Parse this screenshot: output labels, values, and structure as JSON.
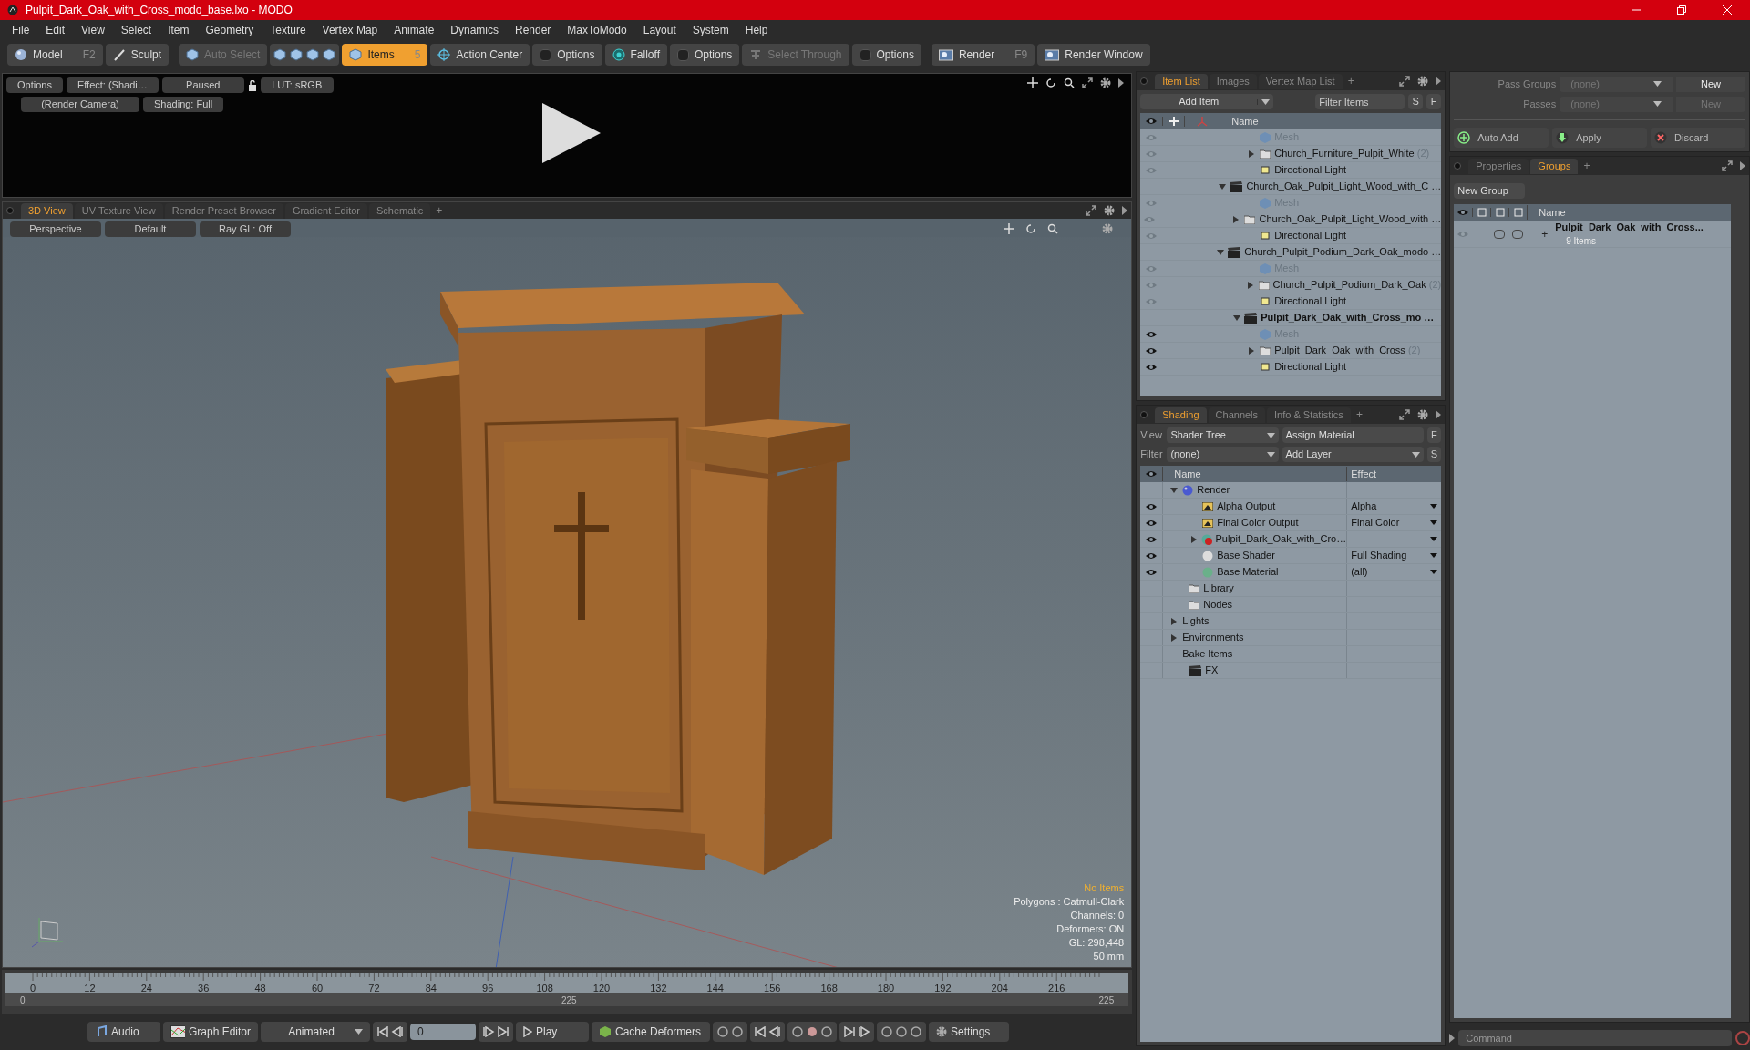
{
  "window": {
    "title": "Pulpit_Dark_Oak_with_Cross_modo_base.lxo - MODO"
  },
  "menu": [
    "File",
    "Edit",
    "View",
    "Select",
    "Item",
    "Geometry",
    "Texture",
    "Vertex Map",
    "Animate",
    "Dynamics",
    "Render",
    "MaxToModo",
    "Layout",
    "System",
    "Help"
  ],
  "toolbar": [
    {
      "kind": "sphere",
      "label": "Model",
      "shortcut": "F2",
      "selected": false,
      "disabled": false
    },
    {
      "kind": "brush",
      "label": "Sculpt",
      "selected": false,
      "disabled": false
    },
    {
      "kind": "cube",
      "label": "Auto Select",
      "selected": false,
      "disabled": true
    },
    {
      "kind": "cubes",
      "selected": false
    },
    {
      "kind": "cube",
      "label": "Items",
      "shortcut": "5",
      "selected": true,
      "disabled": false
    },
    {
      "kind": "target",
      "label": "Action Center",
      "selected": false,
      "disabled": false
    },
    {
      "kind": "options",
      "label": "Options",
      "selected": false,
      "disabled": false
    },
    {
      "kind": "falloff",
      "label": "Falloff",
      "selected": false,
      "disabled": false
    },
    {
      "kind": "options",
      "label": "Options",
      "selected": false,
      "disabled": false
    },
    {
      "kind": "through",
      "label": "Select Through",
      "selected": false,
      "disabled": true
    },
    {
      "kind": "options",
      "label": "Options",
      "selected": false,
      "disabled": false
    },
    {
      "kind": "render",
      "label": "Render",
      "shortcut": "F9",
      "selected": false,
      "disabled": false
    },
    {
      "kind": "render",
      "label": "Render Window",
      "selected": false,
      "disabled": false
    }
  ],
  "preview": {
    "row_1": [
      "Options",
      "Effect: (Shadi…",
      "Paused"
    ],
    "lut": "LUT: sRGB",
    "row_2": [
      "(Render Camera)",
      "Shading: Full"
    ]
  },
  "viewport_tabs": [
    {
      "label": "3D View",
      "selected": true
    },
    {
      "label": "UV Texture View",
      "selected": false
    },
    {
      "label": "Render Preset Browser",
      "selected": false
    },
    {
      "label": "Gradient Editor",
      "selected": false
    },
    {
      "label": "Schematic",
      "selected": false
    }
  ],
  "viewport_add_tab": "+",
  "viewport_bar": [
    "Perspective",
    "Default",
    "Ray GL: Off"
  ],
  "viewport_info": {
    "status": "No Items",
    "lines": [
      "Polygons : Catmull-Clark",
      "Channels: 0",
      "Deformers: ON",
      "GL: 298,448",
      "50 mm"
    ]
  },
  "timeline": {
    "ticks": [
      "0",
      "12",
      "24",
      "36",
      "48",
      "60",
      "72",
      "84",
      "96",
      "108",
      "120",
      "132",
      "144",
      "156",
      "168",
      "180",
      "192",
      "204",
      "216"
    ],
    "range": [
      "0",
      "225",
      "225"
    ]
  },
  "transport": {
    "audio": "Audio",
    "graph_editor": "Graph Editor",
    "mode": "Animated",
    "frame": "0",
    "play": "Play",
    "cache": "Cache Deformers",
    "settings": "Settings"
  },
  "item_list": {
    "tabs": [
      {
        "label": "Item List",
        "selected": true
      },
      {
        "label": "Images",
        "selected": false
      },
      {
        "label": "Vertex Map List",
        "selected": false
      }
    ],
    "add_tab": "+",
    "add_item": "Add Item",
    "filter_placeholder": "Filter Items",
    "filter_buttons": [
      "S",
      "F"
    ],
    "column": "Name",
    "scenes": [
      {
        "children": [
          {
            "kind": "mesh",
            "label": "Mesh",
            "visible": false
          },
          {
            "kind": "group",
            "label": "Church_Furniture_Pulpit_White",
            "count": "(2)",
            "visible": false
          },
          {
            "kind": "light",
            "label": "Directional Light",
            "visible": false
          }
        ]
      },
      {
        "label": "Church_Oak_Pulpit_Light_Wood_with_C …",
        "expanded": true,
        "selected": false,
        "children": [
          {
            "kind": "mesh",
            "label": "Mesh",
            "visible": false
          },
          {
            "kind": "group",
            "label": "Church_Oak_Pulpit_Light_Wood_with …",
            "visible": false
          },
          {
            "kind": "light",
            "label": "Directional Light",
            "visible": false
          }
        ]
      },
      {
        "label": "Church_Pulpit_Podium_Dark_Oak_modo …",
        "expanded": true,
        "selected": false,
        "children": [
          {
            "kind": "mesh",
            "label": "Mesh",
            "visible": false
          },
          {
            "kind": "group",
            "label": "Church_Pulpit_Podium_Dark_Oak",
            "count": "(2)",
            "visible": false
          },
          {
            "kind": "light",
            "label": "Directional Light",
            "visible": false
          }
        ]
      },
      {
        "label": "Pulpit_Dark_Oak_with_Cross_mo …",
        "expanded": true,
        "selected": true,
        "children": [
          {
            "kind": "mesh",
            "label": "Mesh",
            "visible": true
          },
          {
            "kind": "group",
            "label": "Pulpit_Dark_Oak_with_Cross",
            "count": "(2)",
            "visible": true
          },
          {
            "kind": "light",
            "label": "Directional Light",
            "visible": true
          }
        ]
      }
    ]
  },
  "shading": {
    "tabs": [
      {
        "label": "Shading",
        "selected": true
      },
      {
        "label": "Channels",
        "selected": false
      },
      {
        "label": "Info & Statistics",
        "selected": false
      }
    ],
    "add_tab": "+",
    "view_label": "View",
    "view": "Shader Tree",
    "assign": "Assign Material",
    "assign_button": "F",
    "filter_label": "Filter",
    "filter": "(none)",
    "add_layer": "Add Layer",
    "add_button": "S",
    "columns": [
      "Name",
      "Effect"
    ],
    "rows": [
      {
        "kind": "render",
        "label": "Render",
        "expanded": true,
        "children": [
          {
            "kind": "output",
            "label": "Alpha Output",
            "effect": "Alpha",
            "visible": true
          },
          {
            "kind": "output",
            "label": "Final Color Output",
            "effect": "Final Color",
            "visible": true
          },
          {
            "kind": "material",
            "label": "Pulpit_Dark_Oak_with_Cro…",
            "visible": true
          },
          {
            "kind": "shader",
            "label": "Base Shader",
            "effect": "Full Shading",
            "visible": true
          },
          {
            "kind": "base",
            "label": "Base Material",
            "effect": "(all)",
            "visible": true
          }
        ]
      },
      {
        "kind": "folder",
        "label": "Library"
      },
      {
        "kind": "folder",
        "label": "Nodes"
      },
      {
        "kind": "category",
        "label": "Lights",
        "expanded": false
      },
      {
        "kind": "category",
        "label": "Environments",
        "expanded": false
      },
      {
        "kind": "plain",
        "label": "Bake Items"
      },
      {
        "kind": "fx",
        "label": "FX"
      }
    ]
  },
  "passes": [
    {
      "label": "Pass Groups",
      "value": "(none)",
      "new": "New",
      "disabled": false
    },
    {
      "label": "Passes",
      "value": "(none)",
      "new": "New",
      "disabled": true
    }
  ],
  "pass_actions": [
    "Auto Add",
    "Apply",
    "Discard"
  ],
  "groups": {
    "tabs": [
      {
        "label": "Properties",
        "selected": false
      },
      {
        "label": "Groups",
        "selected": true
      }
    ],
    "add_tab": "+",
    "new_group": "New Group",
    "column": "Name",
    "rows": [
      {
        "label": "Pulpit_Dark_Oak_with_Cross...",
        "sub": "9 Items",
        "visible": false,
        "expand": "+",
        "toggles": [
          false,
          false
        ]
      }
    ]
  },
  "command": {
    "placeholder": "Command"
  }
}
